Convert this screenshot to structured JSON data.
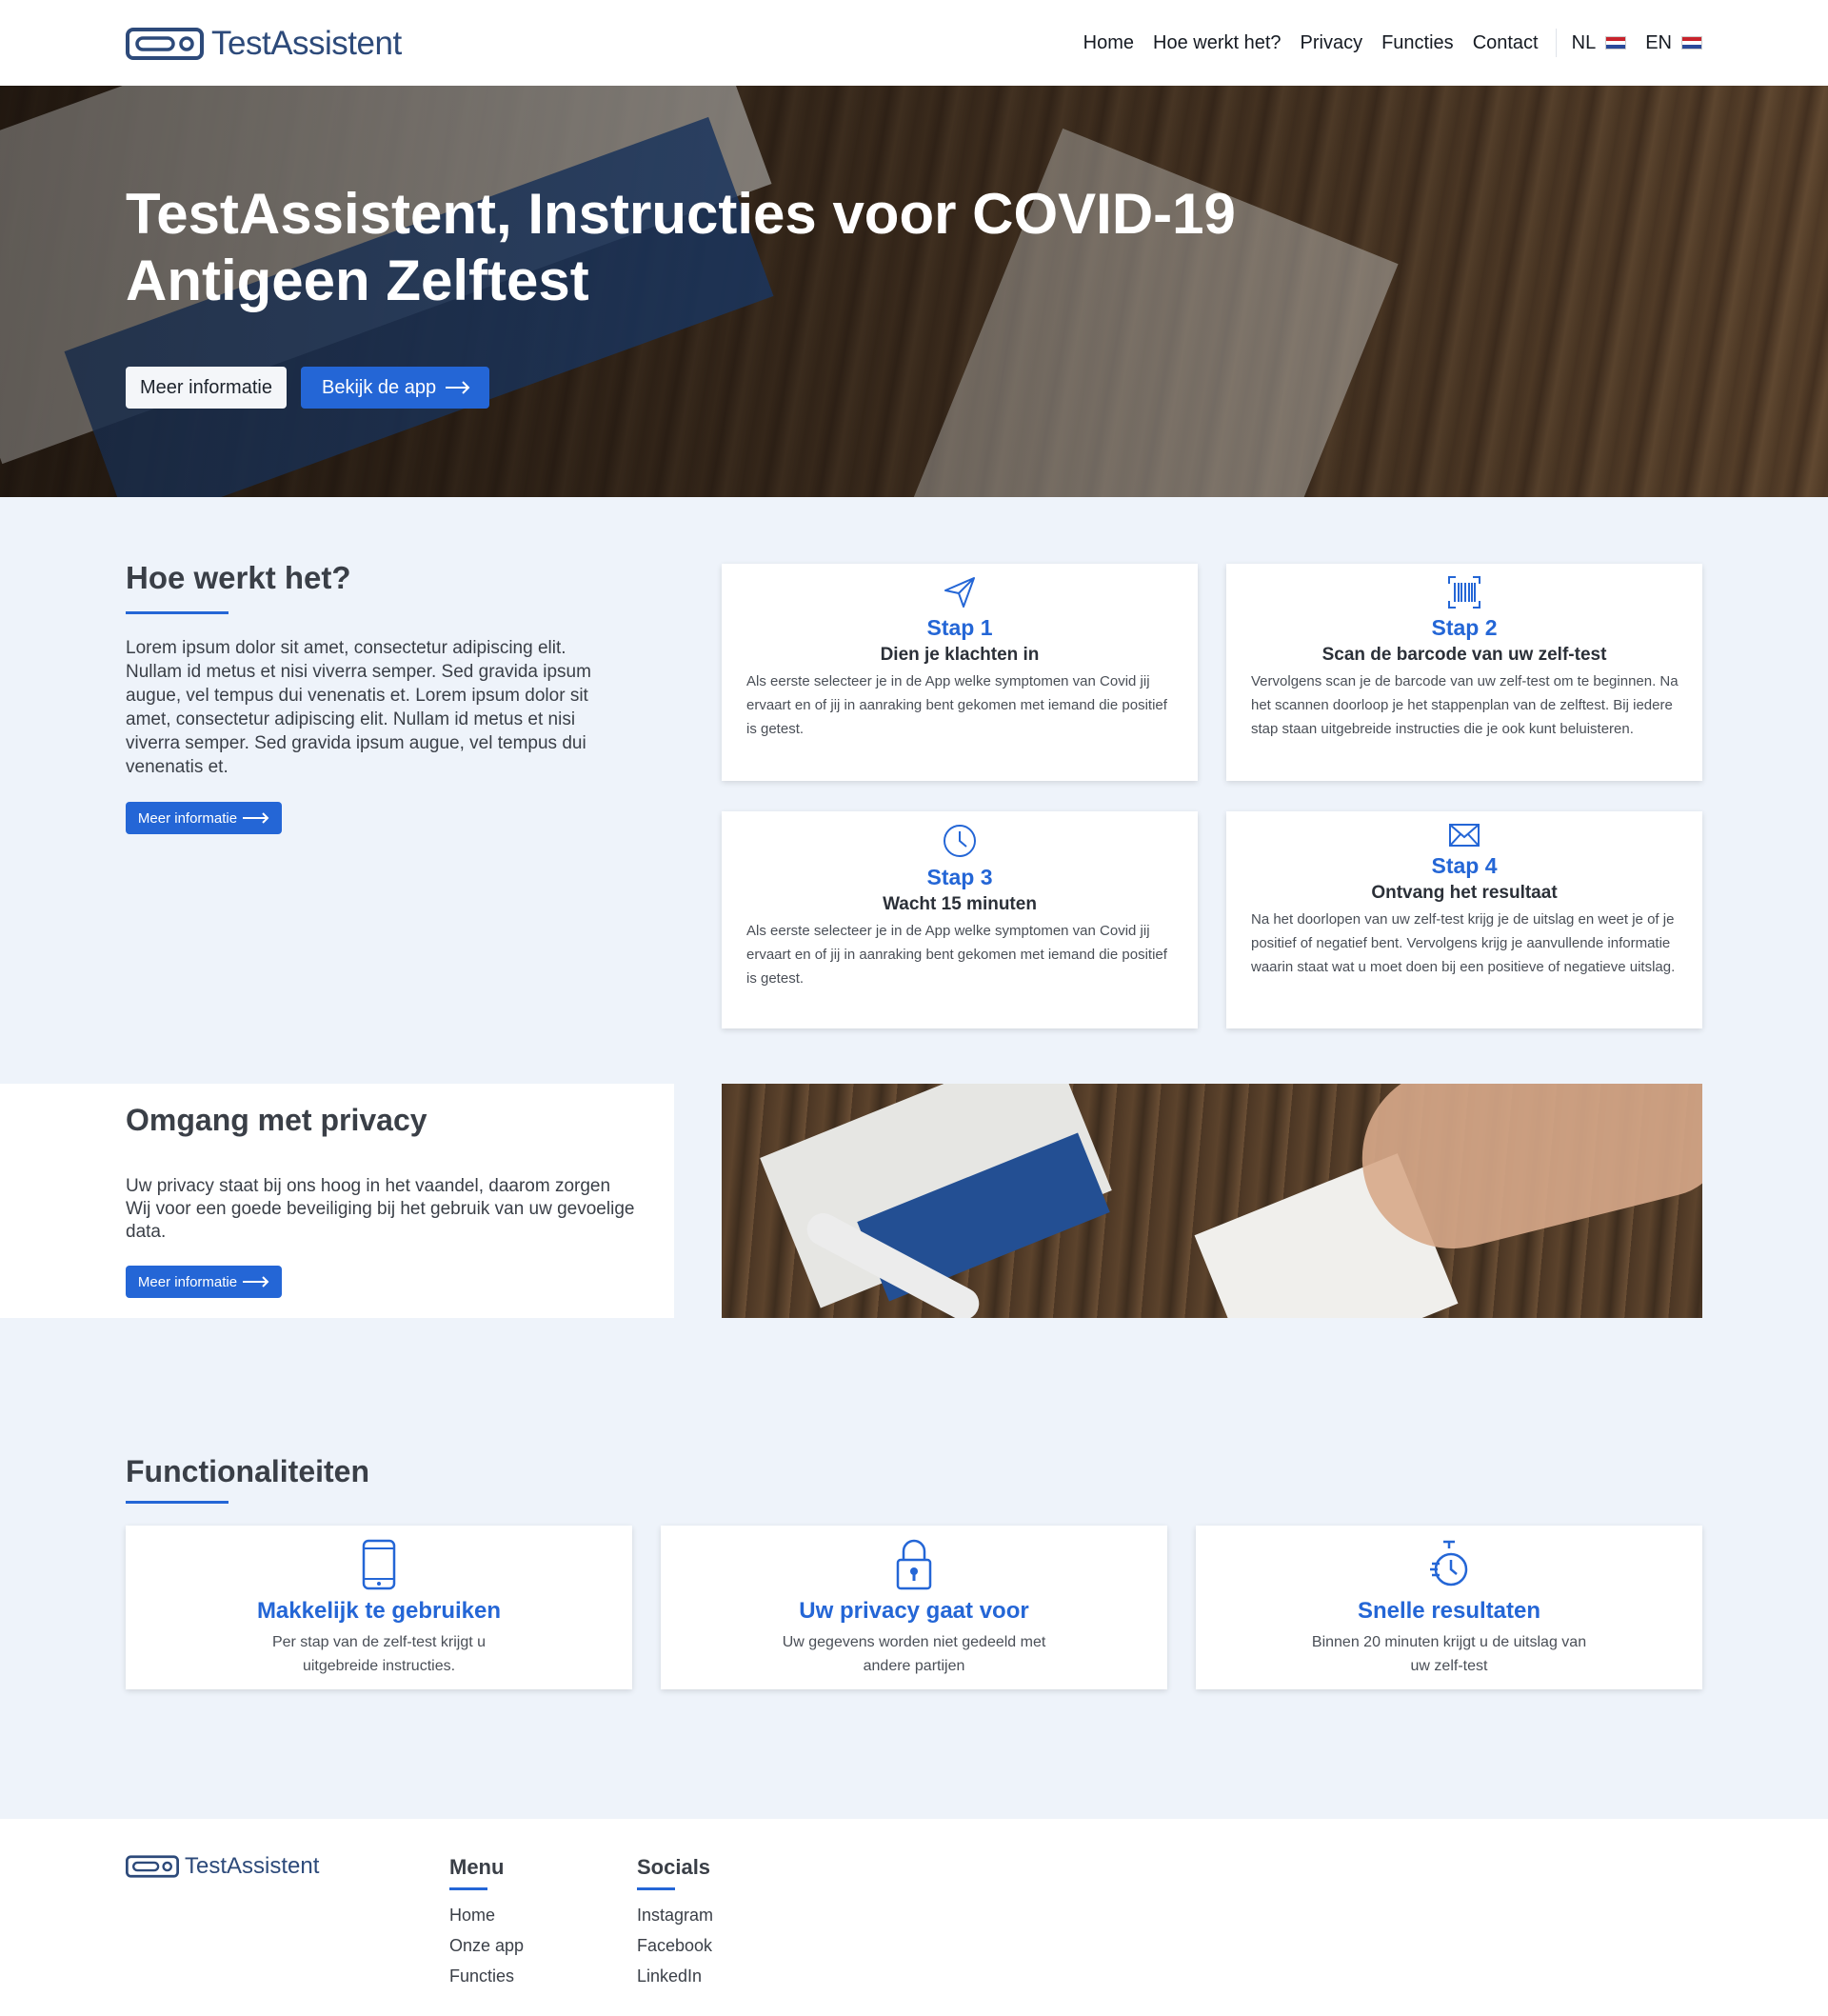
{
  "header": {
    "logo_text": "TestAssistent",
    "nav": [
      "Home",
      "Hoe werkt het?",
      "Privacy",
      "Functies",
      "Contact"
    ],
    "lang_nl": "NL",
    "lang_en": "EN"
  },
  "hero": {
    "title": "TestAssistent, Instructies voor COVID-19 Antigeen Zelftest",
    "btn_info": "Meer informatie",
    "btn_app": "Bekijk de app"
  },
  "how": {
    "title": "Hoe werkt het?",
    "text": "Lorem ipsum dolor sit amet, consectetur adipiscing elit. Nullam id metus et nisi viverra semper. Sed gravida ipsum augue, vel tempus dui venenatis et. Lorem ipsum dolor sit amet, consectetur adipiscing elit. Nullam id metus et nisi viverra semper. Sed gravida ipsum augue, vel tempus dui venenatis et.",
    "btn": "Meer informatie",
    "steps": [
      {
        "icon": "send-icon",
        "title": "Stap 1",
        "subtitle": "Dien je klachten in",
        "text": "Als eerste selecteer je in de App welke symptomen van Covid jij ervaart en of jij in aanraking bent gekomen met iemand die positief is getest."
      },
      {
        "icon": "barcode-icon",
        "title": "Stap 2",
        "subtitle": "Scan de barcode van uw zelf-test",
        "text": "Vervolgens scan je de barcode van uw zelf-test om te beginnen. Na het scannen doorloop je het stappenplan van de zelftest. Bij iedere stap staan uitgebreide instructies die je ook kunt beluisteren."
      },
      {
        "icon": "clock-icon",
        "title": "Stap 3",
        "subtitle": "Wacht 15 minuten",
        "text": "Als eerste selecteer je in de App welke symptomen van Covid jij ervaart en of jij in aanraking bent gekomen met iemand die positief is getest."
      },
      {
        "icon": "mail-icon",
        "title": "Stap 4",
        "subtitle": "Ontvang het resultaat",
        "text": "Na het doorlopen van uw zelf-test krijg je de uitslag en weet je of je positief of negatief bent. Vervolgens krijg je aanvullende informatie waarin staat wat u moet doen bij een positieve of negatieve uitslag."
      }
    ]
  },
  "privacy": {
    "title": "Omgang met privacy",
    "text": "Uw privacy staat bij ons hoog in het vaandel, daarom zorgen Wij voor een goede beveiliging bij het gebruik van uw gevoelige data.",
    "btn": "Meer informatie"
  },
  "features": {
    "title": "Functionaliteiten",
    "items": [
      {
        "icon": "smartphone-icon",
        "title": "Makkelijk te gebruiken",
        "text": "Per stap van de zelf-test krijgt u uitgebreide instructies."
      },
      {
        "icon": "lock-icon",
        "title": "Uw privacy gaat voor",
        "text": "Uw gegevens worden niet gedeeld met andere partijen"
      },
      {
        "icon": "stopwatch-icon",
        "title": "Snelle resultaten",
        "text": "Binnen 20 minuten krijgt u de uitslag van uw zelf-test"
      }
    ]
  },
  "footer": {
    "logo_text": "TestAssistent",
    "menu_title": "Menu",
    "menu": [
      "Home",
      "Onze app",
      "Functies"
    ],
    "socials_title": "Socials",
    "socials": [
      "Instagram",
      "Facebook",
      "LinkedIn"
    ]
  }
}
